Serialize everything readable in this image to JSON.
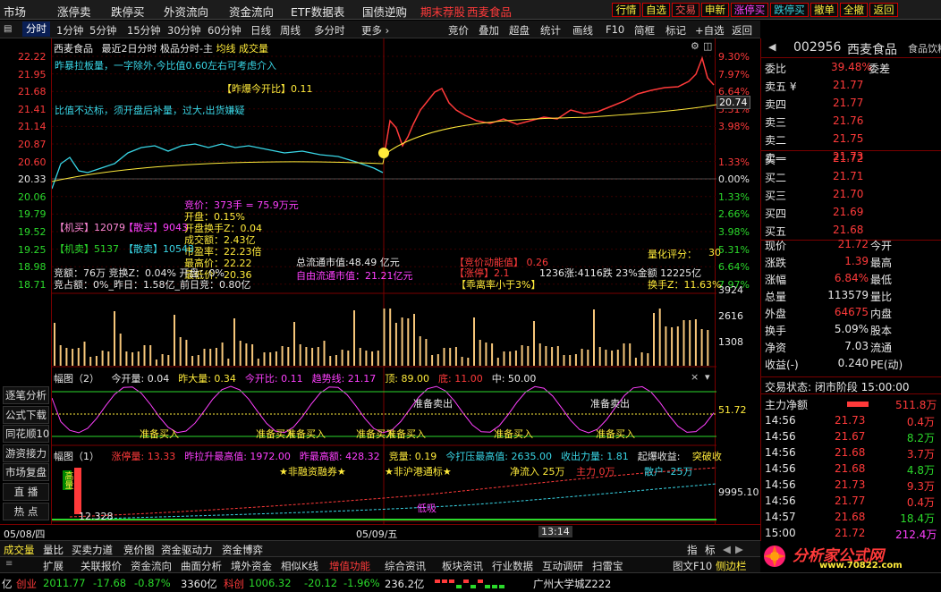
{
  "menubar": {
    "items": [
      "市场",
      "涨停卖",
      "跌停买",
      "外资流向",
      "资金流向",
      "ETF数据表",
      "国债逆购"
    ],
    "promo": [
      "期末荐股",
      "西麦食品"
    ],
    "buttons": [
      {
        "label": "行情",
        "color": "#ffeb3b"
      },
      {
        "label": "自选",
        "color": "#ffeb3b"
      },
      {
        "label": "交易",
        "color": "#ff5050"
      },
      {
        "label": "申新",
        "color": "#ffeb3b"
      },
      {
        "label": "涨停买",
        "color": "#ff40ff"
      },
      {
        "label": "跌停买",
        "color": "#39d6e6"
      },
      {
        "label": "撤单",
        "color": "#ffeb3b"
      },
      {
        "label": "全撤",
        "color": "#ffeb3b"
      },
      {
        "label": "返回",
        "color": "#ffeb3b"
      }
    ]
  },
  "tabbar": {
    "left": [
      "分时",
      "1分钟",
      "5分钟",
      "15分钟",
      "30分钟",
      "60分钟",
      "日线",
      "周线",
      "多分时",
      "更多 ›"
    ],
    "right": [
      "竞价",
      "叠加",
      "超盘",
      "统计",
      "画线",
      "F10",
      "简框",
      "标记",
      "+自选",
      "返回"
    ]
  },
  "chart_header": {
    "stock": "西麦食品",
    "period": "最近2日分时",
    "mode": "极品分时-主",
    "avg": "均线",
    "vol": "成交量"
  },
  "left_axis": [
    "22.22",
    "21.95",
    "21.68",
    "21.41",
    "21.14",
    "20.87",
    "20.60",
    "20.33",
    "20.06",
    "19.79",
    "19.52",
    "19.25",
    "18.98",
    "18.71"
  ],
  "right_axis": [
    "9.30%",
    "7.97%",
    "6.64%",
    "5.31%",
    "3.98%",
    "",
    "1.33%",
    "0.00%",
    "1.33%",
    "2.66%",
    "3.98%",
    "5.31%",
    "6.64%",
    "7.97%"
  ],
  "right_axis_current": "20.74",
  "vol_axis": [
    "3924",
    "2616",
    "1308"
  ],
  "chart_texts": {
    "t1": "昨暴拉板量，一字除外,今比值0.60左右可考虑介入",
    "t2": "【昨爆今开比】0.11",
    "t3": "比值不达标，须开盘后补量，过大,出货嫌疑",
    "t4": "竞价：373手 = 75.9万元",
    "t5": "开盘：0.15%",
    "t6": "开盘换手Z：0.04",
    "t7": "成交额：2.43亿",
    "t8": "市盈率：22.23倍",
    "t9": "最高价：22.22",
    "t10": "最低价：20.36",
    "t11": "【机买】12079",
    "t12": "【散买】9043",
    "t13": "【机卖】5137",
    "t14": "【散卖】10543",
    "t15": "总流通市值:48.49 亿元",
    "t16": "自由流通市值：21.21亿元",
    "t17": "【竞价动能值】 0.26",
    "t18": "【涨停】2.1",
    "t19": "1236涨:4116跌 23%金额 12225亿",
    "t20": "量化评分：",
    "t21": "30",
    "t22": "竞额：76万 竞换Z：0.04% 开盘：0%",
    "t23": "竞占额：0%_昨日：1.58亿_前日竞：0.80亿",
    "t24": "【乖离率小于3%】",
    "t25": "换手Z：11.63%"
  },
  "ind1": {
    "title": "幅图（2）",
    "items": [
      {
        "k": "今开量: 0.04",
        "c": "#e8e8e8"
      },
      {
        "k": "昨大量: 0.34",
        "c": "#ffeb3b"
      },
      {
        "k": "今开比: 0.11",
        "c": "#ff40ff"
      },
      {
        "k": "趋势线: 21.17",
        "c": "#ff40ff"
      },
      {
        "k": "顶: 89.00",
        "c": "#ffeb3b"
      },
      {
        "k": "底: 11.00",
        "c": "#ff3a3a"
      },
      {
        "k": "中: 50.00",
        "c": "#e8e8e8"
      }
    ],
    "axis": "51.72",
    "labels": [
      "准备卖出",
      "准备卖出",
      "准备买入",
      "准备买入",
      "准备买入",
      "准备买入",
      "准备买入",
      "准备买入",
      "准备买入"
    ]
  },
  "ind2": {
    "title": "幅图（1）",
    "items": [
      {
        "k": "涨停量: 13.33",
        "c": "#ff3a3a"
      },
      {
        "k": "昨拉升最高值: 1972.00",
        "c": "#ff40ff"
      },
      {
        "k": "昨最高额: 428.32",
        "c": "#ff40ff"
      },
      {
        "k": "竞量: 0.19",
        "c": "#ffeb3b"
      },
      {
        "k": "今打压最高值: 2635.00",
        "c": "#39d6e6"
      },
      {
        "k": "收出力量: 1.81",
        "c": "#39d6e6"
      },
      {
        "k": "起爆收益: ",
        "c": "#e8e8e8"
      },
      {
        "k": "突破收",
        "c": "#ffeb3b"
      }
    ],
    "axis": "9995.10",
    "t1": "★非融资融券★",
    "t2": "★非沪港通标★",
    "t3": "净流入 25万",
    "t4": "主力 0万",
    "t5": "散户 -25万",
    "t6": "高量",
    "t7": "12.328",
    "t8": "低吸"
  },
  "left_nav": [
    "逐笔分析",
    "公式下载",
    "同花顺10",
    "游资接力",
    "市场复盘",
    "直 播",
    "热 点"
  ],
  "dates": {
    "d1": "05/08/四",
    "d2": "05/09/五",
    "time": "13:14"
  },
  "bottom_tabs": [
    "成交量",
    "量比",
    "买卖力道",
    "竞价图",
    "资金驱动力",
    "资金博弈"
  ],
  "bottom_right": [
    "指",
    "标"
  ],
  "bottom2": [
    "扩展",
    "关联报价",
    "资金流向",
    "曲面分析",
    "境外资金",
    "相似K线",
    "增值功能",
    "综合资讯",
    "板块资讯",
    "行业数据",
    "互动调研",
    "扫雷宝",
    "图文F10",
    "侧边栏"
  ],
  "status": {
    "s1": "亿",
    "idx": "创业",
    "v1": "2011.77",
    "v2": "-17.68",
    "v3": "-0.87%",
    "v4": "3360亿",
    "idx2": "科创",
    "v5": "1006.32",
    "v6": "-20.12",
    "v7": "-1.96%",
    "v8": "236.2亿",
    "news": "广州大学城Z222"
  },
  "rp": {
    "code": "002956",
    "name": "西麦食品",
    "tag": "食品饮料",
    "weibi_label": "委比",
    "weibi": "39.48%",
    "weicha_label": "委差",
    "asks": [
      {
        "l": "卖五 ¥",
        "p": "21.77"
      },
      {
        "l": "卖四",
        "p": "21.77"
      },
      {
        "l": "卖三",
        "p": "21.76"
      },
      {
        "l": "卖二",
        "p": "21.75"
      },
      {
        "l": "卖一",
        "p": "21.73"
      }
    ],
    "bids": [
      {
        "l": "买一",
        "p": "21.72"
      },
      {
        "l": "买二",
        "p": "21.71"
      },
      {
        "l": "买三",
        "p": "21.70"
      },
      {
        "l": "买四",
        "p": "21.69"
      },
      {
        "l": "买五",
        "p": "21.68"
      }
    ],
    "stats": [
      {
        "l": "现价",
        "v": "21.72",
        "c": "red",
        "r": "今开"
      },
      {
        "l": "涨跌",
        "v": "1.39",
        "c": "red",
        "r": "最高"
      },
      {
        "l": "涨幅",
        "v": "6.84%",
        "c": "red",
        "r": "最低"
      },
      {
        "l": "总量",
        "v": "113579",
        "c": "wh",
        "r": "量比"
      },
      {
        "l": "外盘",
        "v": "64675",
        "c": "red",
        "r": "内盘"
      },
      {
        "l": "换手",
        "v": "5.09%",
        "c": "wh",
        "r": "股本"
      },
      {
        "l": "净资",
        "v": "7.03",
        "c": "wh",
        "r": "流通"
      },
      {
        "l": "收益(-)",
        "v": "0.240",
        "c": "wh",
        "r": "PE(动)"
      }
    ],
    "trade_status": "交易状态: 闭市阶段 15:00:00",
    "net_label": "主力净额",
    "net_val": "511.8万",
    "ticks": [
      {
        "t": "14:56",
        "p": "21.73",
        "v": "0.4万",
        "c": "red"
      },
      {
        "t": "14:56",
        "p": "21.67",
        "v": "8.2万",
        "c": "grn"
      },
      {
        "t": "14:56",
        "p": "21.68",
        "v": "3.7万",
        "c": "red"
      },
      {
        "t": "14:56",
        "p": "21.68",
        "v": "4.8万",
        "c": "grn"
      },
      {
        "t": "14:56",
        "p": "21.73",
        "v": "9.3万",
        "c": "red"
      },
      {
        "t": "14:56",
        "p": "21.77",
        "v": "0.4万",
        "c": "red"
      },
      {
        "t": "14:57",
        "p": "21.68",
        "v": "18.4万",
        "c": "grn"
      },
      {
        "t": "15:00",
        "p": "21.72",
        "v": "212.4万",
        "c": "mag"
      }
    ]
  },
  "logo": {
    "name": "分析家公式网",
    "url": "www.70822.com"
  }
}
